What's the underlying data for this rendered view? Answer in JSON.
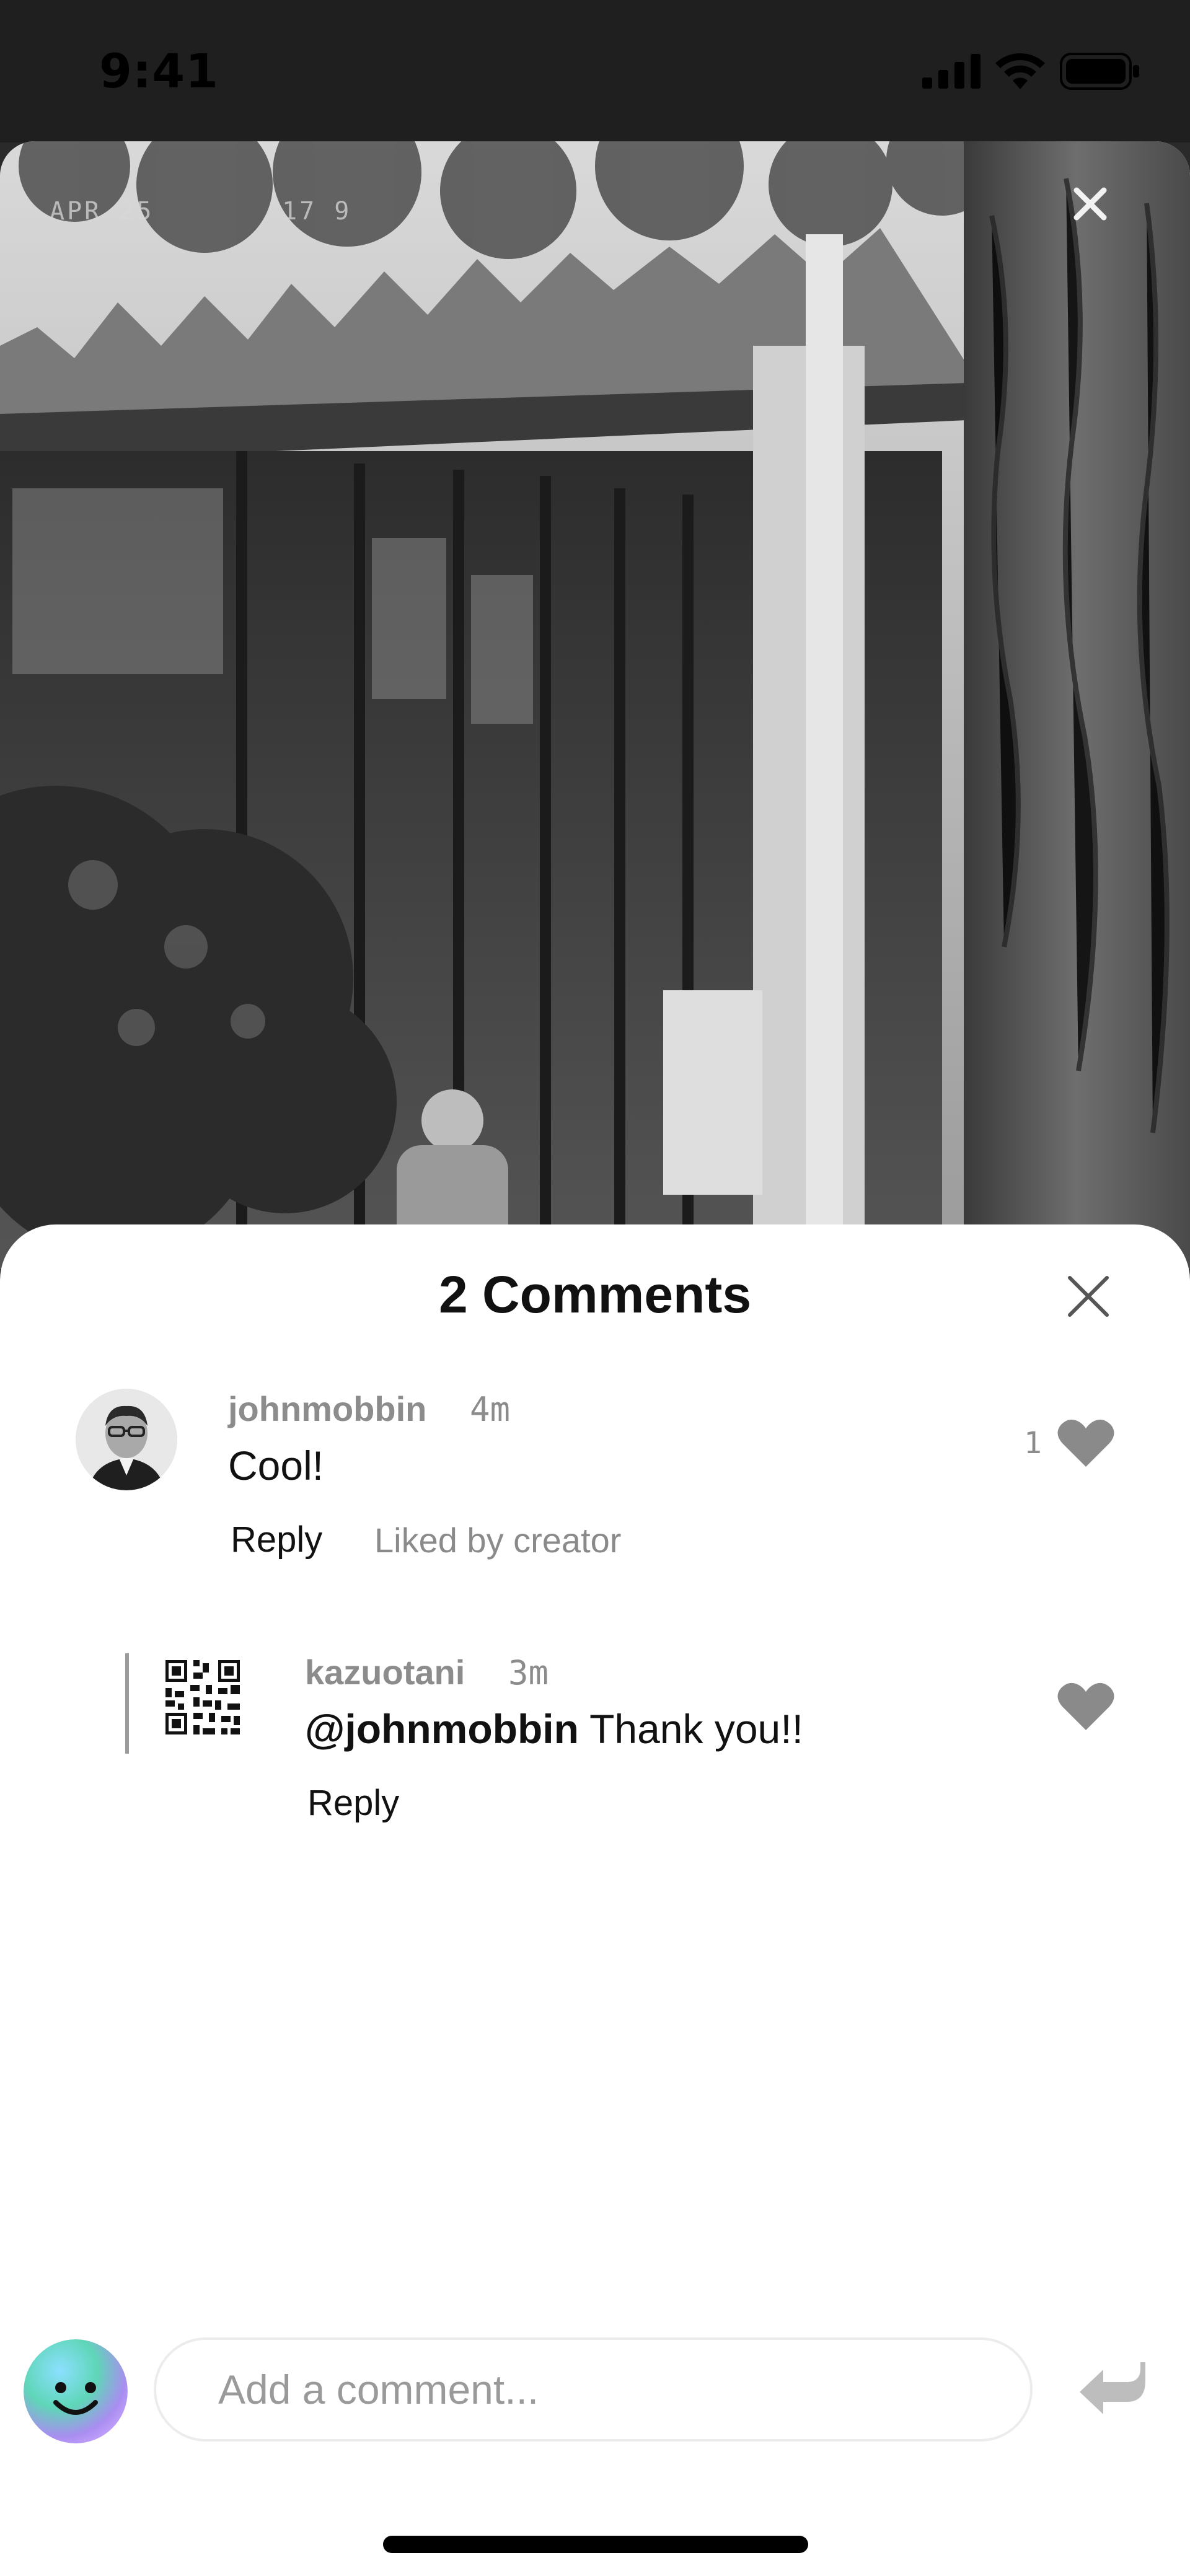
{
  "status_bar": {
    "time": "9:41"
  },
  "photo": {
    "date_stamp": "APR 25",
    "time_stamp": "17  9"
  },
  "comments_sheet": {
    "title": "2 Comments",
    "comments": [
      {
        "username": "johnmobbin",
        "time": "4m",
        "text": "Cool!",
        "reply_label": "Reply",
        "liked_by_creator": "Liked by creator",
        "like_count": "1"
      },
      {
        "username": "kazuotani",
        "time": "3m",
        "mention": "@johnmobbin",
        "text": " Thank you!!",
        "reply_label": "Reply"
      }
    ]
  },
  "composer": {
    "placeholder": "Add a comment..."
  },
  "colors": {
    "heart": "#8a8a8a",
    "muted_text": "#8c8c8c",
    "emoji_avatar": "#63d6c8"
  }
}
